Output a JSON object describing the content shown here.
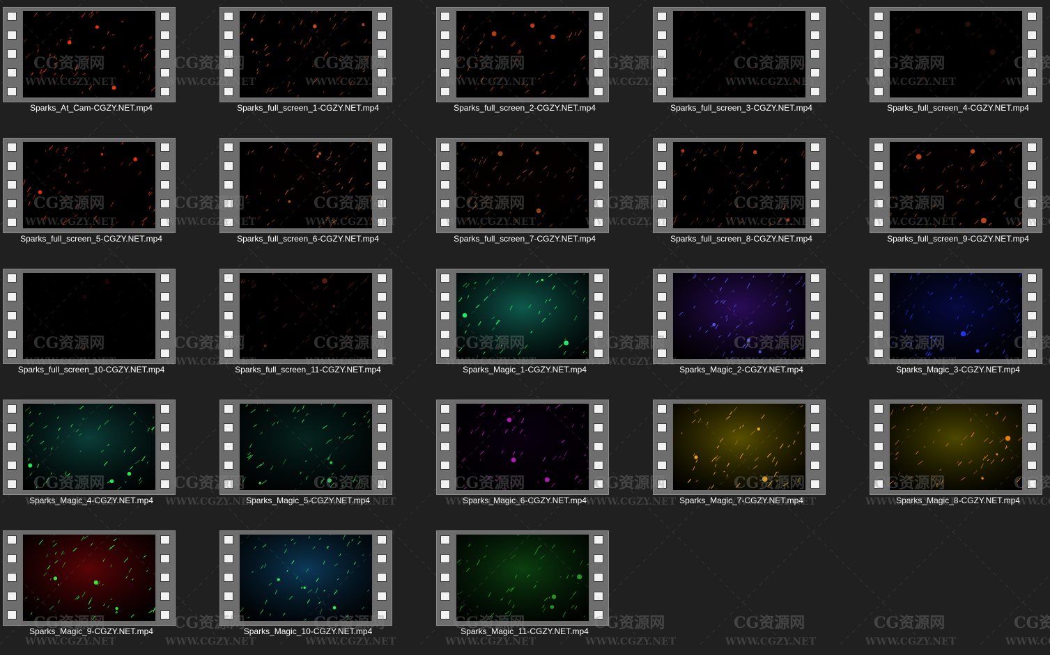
{
  "files": [
    {
      "name": "Sparks_At_Cam-CGZY.NET.mp4",
      "bg": "#000000",
      "spark": "#ff3a10"
    },
    {
      "name": "Sparks_full_screen_1-CGZY.NET.mp4",
      "bg": "#020000",
      "spark": "#d4501a"
    },
    {
      "name": "Sparks_full_screen_2-CGZY.NET.mp4",
      "bg": "#020000",
      "spark": "#d04018"
    },
    {
      "name": "Sparks_full_screen_3-CGZY.NET.mp4",
      "bg": "#000000",
      "spark": "#401008"
    },
    {
      "name": "Sparks_full_screen_4-CGZY.NET.mp4",
      "bg": "#000000",
      "spark": "#301008"
    },
    {
      "name": "Sparks_full_screen_5-CGZY.NET.mp4",
      "bg": "#030000",
      "spark": "#ff3010"
    },
    {
      "name": "Sparks_full_screen_6-CGZY.NET.mp4",
      "bg": "#040100",
      "spark": "#d05a1c"
    },
    {
      "name": "Sparks_full_screen_7-CGZY.NET.mp4",
      "bg": "#050200",
      "spark": "#a04a18"
    },
    {
      "name": "Sparks_full_screen_8-CGZY.NET.mp4",
      "bg": "#020000",
      "spark": "#c04018"
    },
    {
      "name": "Sparks_full_screen_9-CGZY.NET.mp4",
      "bg": "#030000",
      "spark": "#d04a1a"
    },
    {
      "name": "Sparks_full_screen_10-CGZY.NET.mp4",
      "bg": "#000000",
      "spark": "#200806"
    },
    {
      "name": "Sparks_full_screen_11-CGZY.NET.mp4",
      "bg": "#020000",
      "spark": "#602010"
    },
    {
      "name": "Sparks_Magic_1-CGZY.NET.mp4",
      "bg": "#0f5a4e",
      "spark": "#2cff6a"
    },
    {
      "name": "Sparks_Magic_2-CGZY.NET.mp4",
      "bg": "#2a0c5a",
      "spark": "#5a5aff"
    },
    {
      "name": "Sparks_Magic_3-CGZY.NET.mp4",
      "bg": "#060a40",
      "spark": "#2a3aff"
    },
    {
      "name": "Sparks_Magic_4-CGZY.NET.mp4",
      "bg": "#0b3d38",
      "spark": "#2cff5a"
    },
    {
      "name": "Sparks_Magic_5-CGZY.NET.mp4",
      "bg": "#062420",
      "spark": "#2ce05a"
    },
    {
      "name": "Sparks_Magic_6-CGZY.NET.mp4",
      "bg": "#0a0010",
      "spark": "#c020c0"
    },
    {
      "name": "Sparks_Magic_7-CGZY.NET.mp4",
      "bg": "#5a5000",
      "spark": "#ffb010"
    },
    {
      "name": "Sparks_Magic_8-CGZY.NET.mp4",
      "bg": "#4e4800",
      "spark": "#ff8a10"
    },
    {
      "name": "Sparks_Magic_9-CGZY.NET.mp4",
      "bg": "#5a0406",
      "spark": "#3aff3a"
    },
    {
      "name": "Sparks_Magic_10-CGZY.NET.mp4",
      "bg": "#0c3a5a",
      "spark": "#3aff6a"
    },
    {
      "name": "Sparks_Magic_11-CGZY.NET.mp4",
      "bg": "#0c4010",
      "spark": "#2aa02a"
    }
  ],
  "watermark": {
    "brand": "CG资源网",
    "url": "WWW.CGZY.NET",
    "color": "#8a8a8a"
  }
}
